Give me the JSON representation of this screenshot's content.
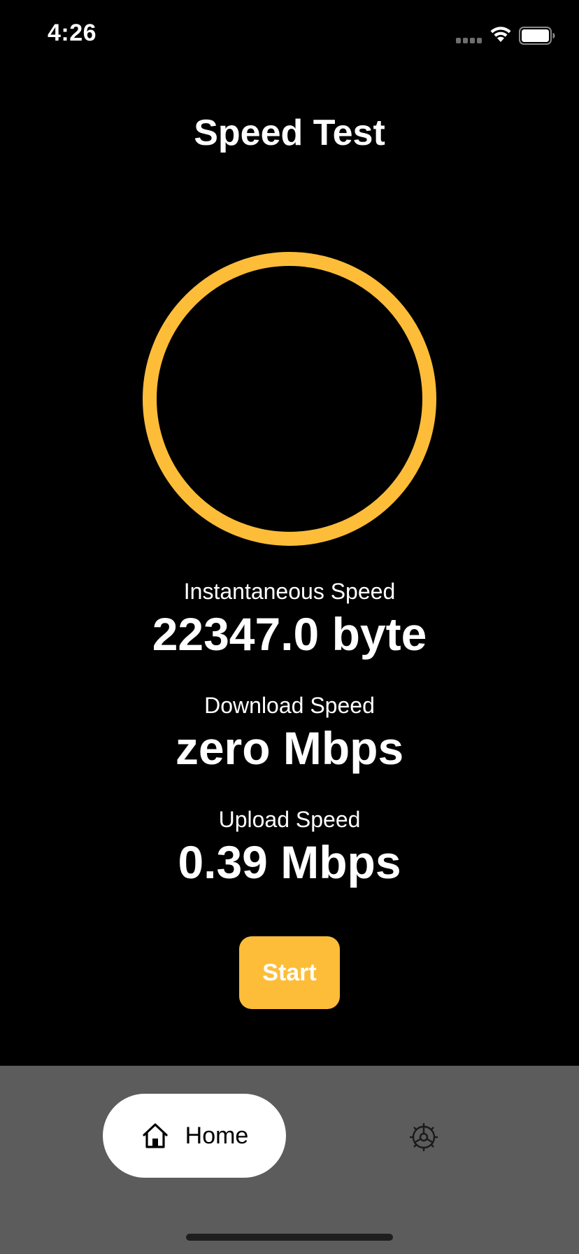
{
  "status_bar": {
    "time": "4:26"
  },
  "header": {
    "title": "Speed Test"
  },
  "gauge": {
    "ring_color": "#fdbd39"
  },
  "metrics": {
    "instantaneous": {
      "label": "Instantaneous Speed",
      "value": "22347.0 byte"
    },
    "download": {
      "label": "Download Speed",
      "value": "zero Mbps"
    },
    "upload": {
      "label": "Upload Speed",
      "value": "0.39 Mbps"
    }
  },
  "actions": {
    "start_label": "Start"
  },
  "tab_bar": {
    "home_label": "Home",
    "home_icon": "house-icon",
    "settings_icon": "gear-icon"
  },
  "colors": {
    "accent": "#fdbd39",
    "background": "#000000",
    "tab_bar_background": "#5b5c5b"
  }
}
